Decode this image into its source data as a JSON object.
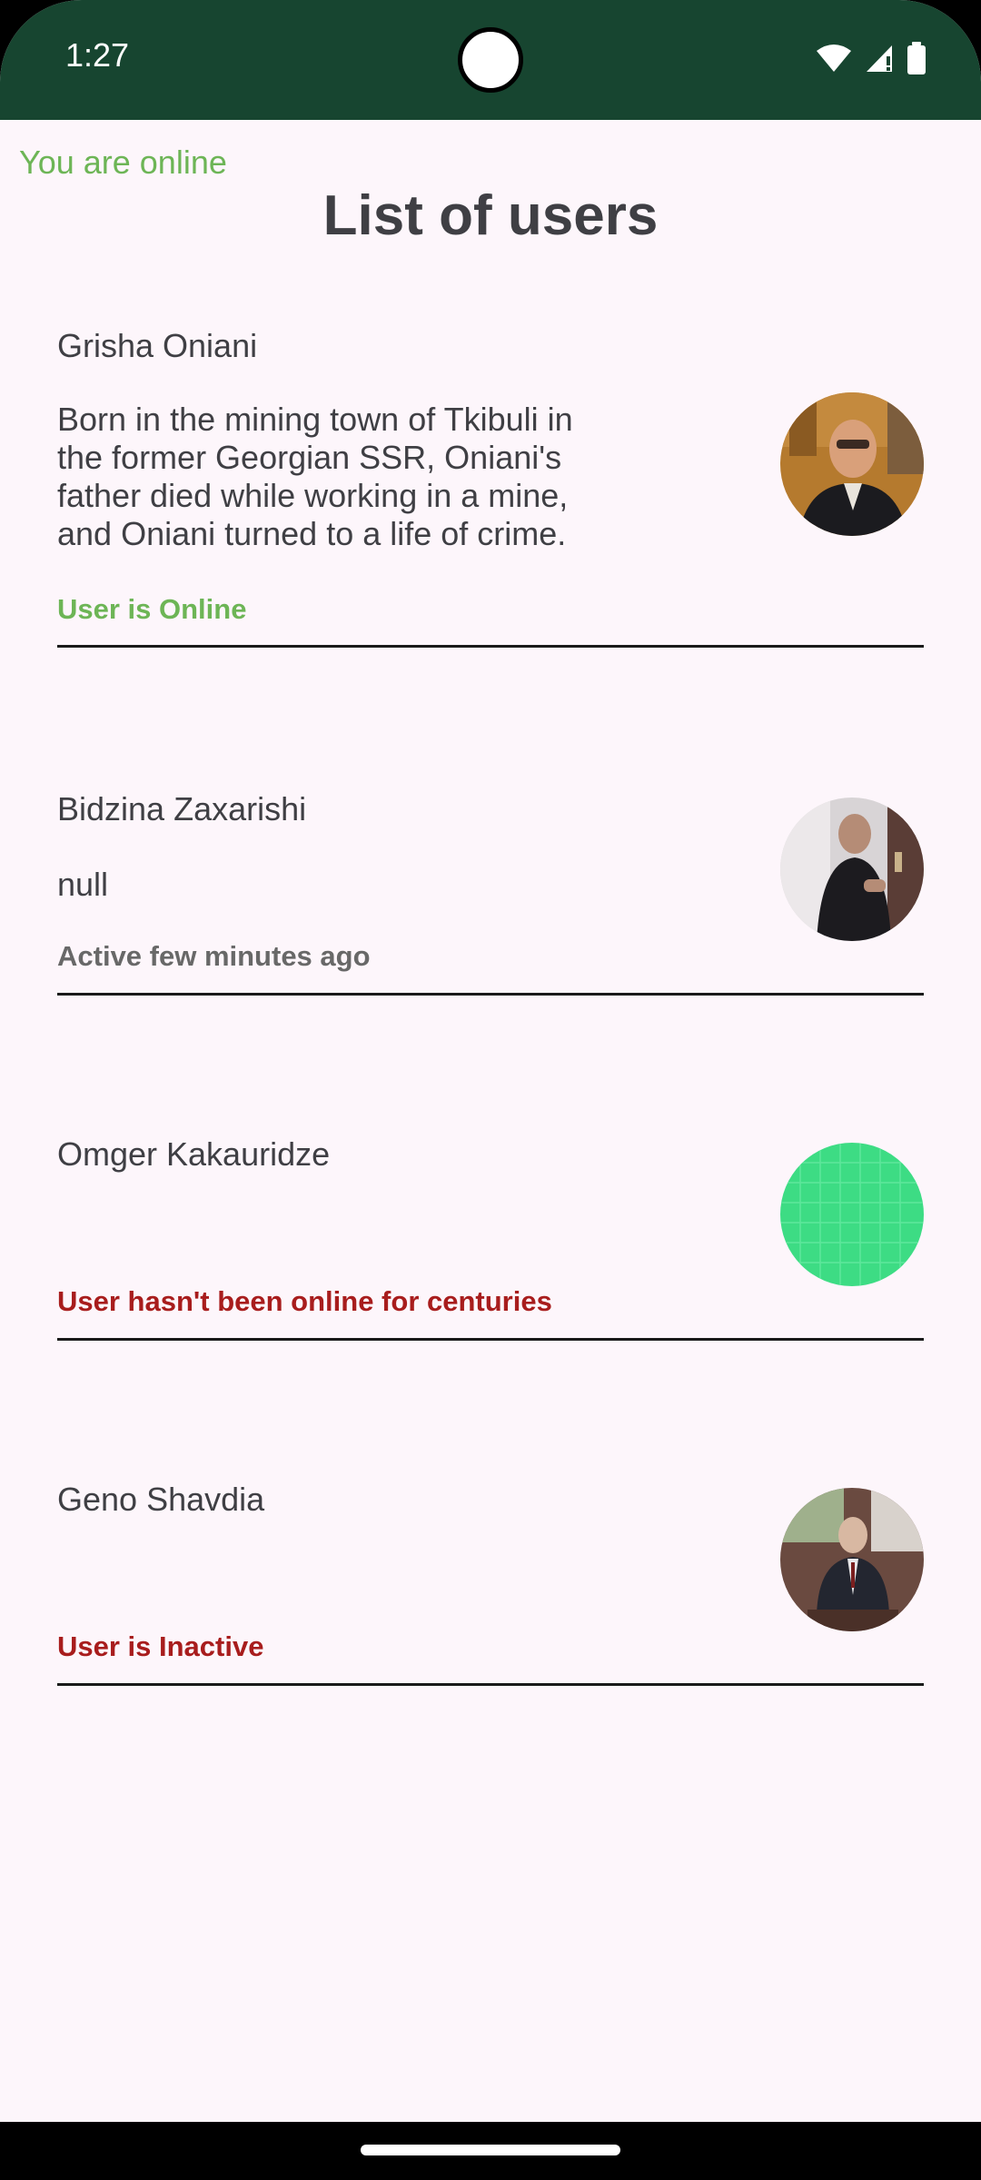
{
  "status_bar": {
    "time": "1:27",
    "icons": [
      "wifi-icon",
      "signal-icon",
      "battery-icon"
    ],
    "background": "#174530"
  },
  "connection_banner": "You are online",
  "page_title": "List of users",
  "users": [
    {
      "name": "Grisha Oniani",
      "bio": "Born in the mining town of Tkibuli in the former Georgian SSR, Oniani's father died while working in a mine, and Oniani turned to a life of crime.",
      "status": "User is Online",
      "status_color": "#6db556",
      "avatar": "photo"
    },
    {
      "name": "Bidzina Zaxarishi",
      "bio": "null",
      "status": "Active few minutes ago",
      "status_color": "#686868",
      "avatar": "photo"
    },
    {
      "name": "Omger Kakauridze",
      "bio": "",
      "status": "User hasn't been online for centuries",
      "status_color": "#a81d1d",
      "avatar": "placeholder-green"
    },
    {
      "name": "Geno Shavdia",
      "bio": "",
      "status": "User is Inactive",
      "status_color": "#a81d1d",
      "avatar": "photo"
    }
  ]
}
